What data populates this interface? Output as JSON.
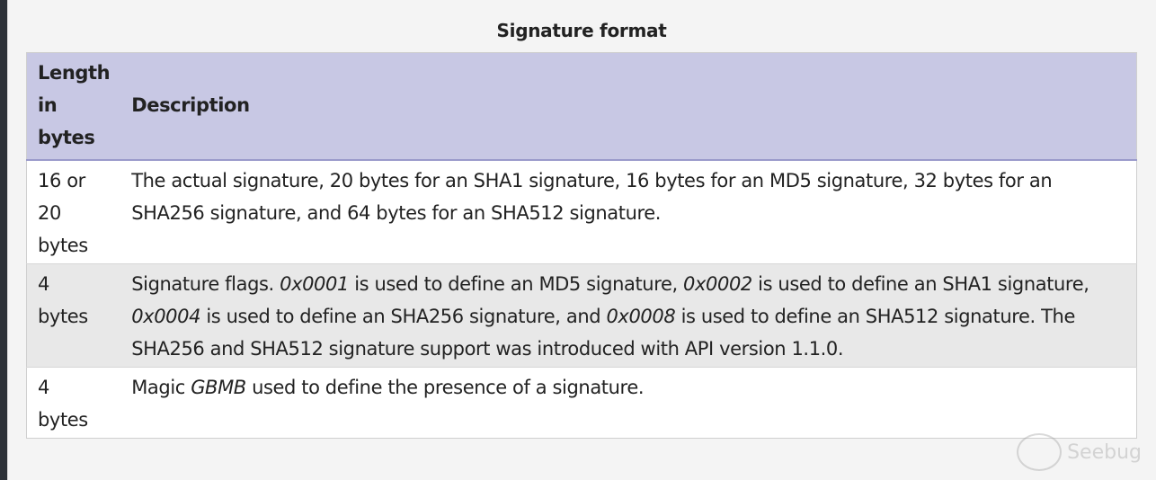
{
  "caption": "Signature format",
  "table": {
    "headers": {
      "length_lines": [
        "Length",
        "in",
        "bytes"
      ],
      "description": "Description"
    },
    "rows": [
      {
        "length_lines": [
          "16 or",
          "20",
          "bytes"
        ],
        "description": {
          "p1": "The actual signature, 20 bytes for an SHA1 signature, 16 bytes for an MD5 signature, 32 bytes for an SHA256 signature, and 64 bytes for an SHA512 signature."
        }
      },
      {
        "length_lines": [
          "4",
          "bytes"
        ],
        "description": {
          "p1": "Signature flags. ",
          "c1": "0x0001",
          "p2": " is used to define an MD5 signature, ",
          "c2": "0x0002",
          "p3": " is used to define an SHA1 signature, ",
          "c3": "0x0004",
          "p4": " is used to define an SHA256 signature, and ",
          "c4": "0x0008",
          "p5": " is used to define an SHA512 signature. The SHA256 and SHA512 signature support was introduced with API version 1.1.0."
        }
      },
      {
        "length_lines": [
          "4",
          "bytes"
        ],
        "description": {
          "p1": "Magic ",
          "c1": "GBMB",
          "p2": " used to define the presence of a signature."
        }
      }
    ]
  },
  "watermark": {
    "icon": "seebug-logo-icon",
    "text": "Seebug"
  }
}
